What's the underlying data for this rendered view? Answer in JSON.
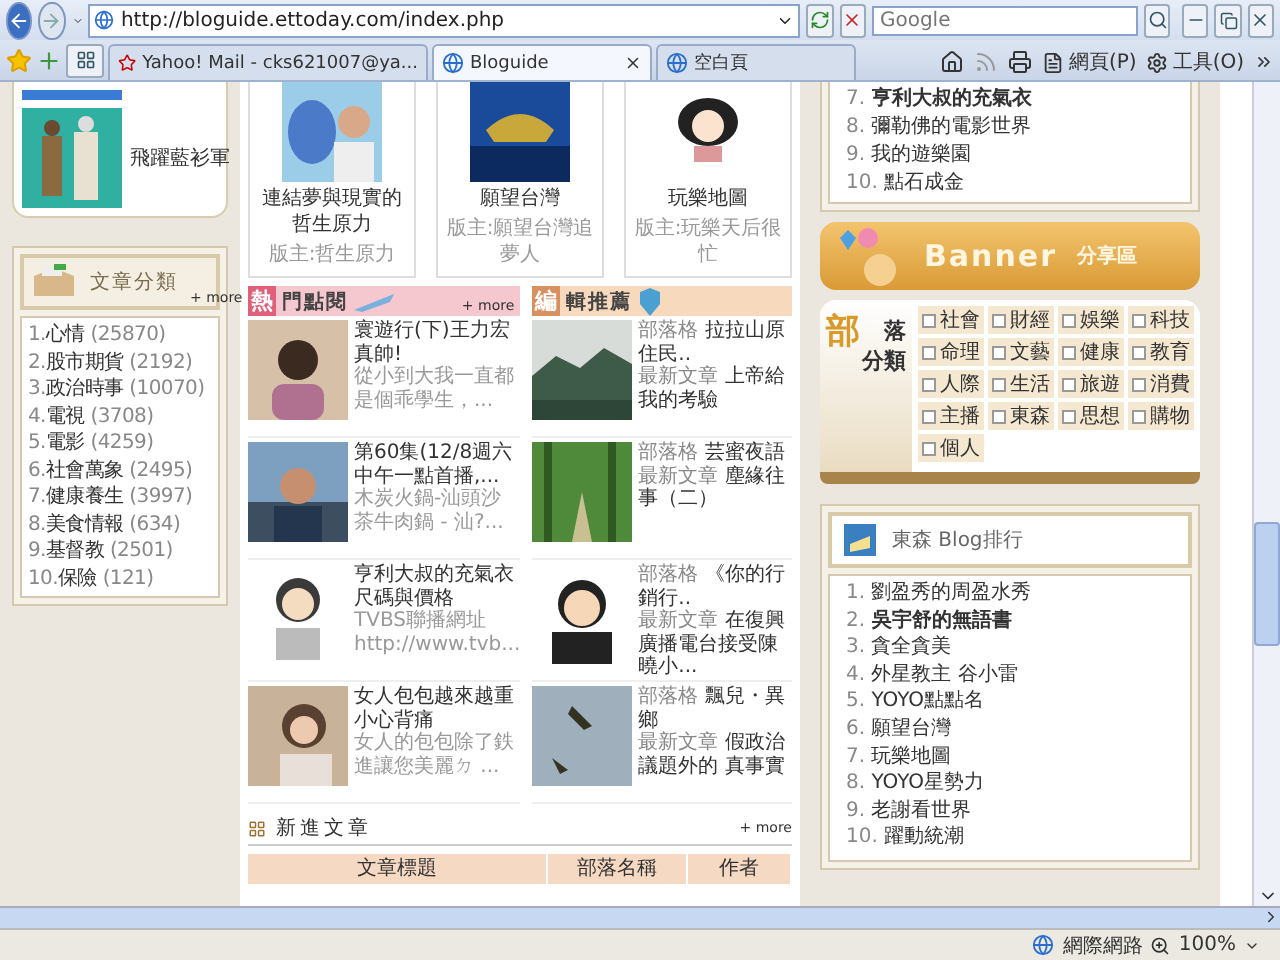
{
  "browser": {
    "url": "http://bloguide.ettoday.com/index.php",
    "search_placeholder": "Google",
    "tabs": [
      {
        "label": "Yahoo! Mail - cks621007@ya...",
        "kind": "yahoo",
        "selected": false
      },
      {
        "label": "Bloguide",
        "kind": "ie",
        "selected": true
      },
      {
        "label": "空白頁",
        "kind": "ie",
        "selected": false
      }
    ],
    "menus": [
      "網頁(P)",
      "工具(O)"
    ]
  },
  "left": {
    "featured": {
      "name": "飛躍藍衫軍"
    },
    "categories": {
      "title": "文章分類",
      "more": "+ more",
      "items": [
        {
          "rank": "1.",
          "name": "心情",
          "count": "(25870)"
        },
        {
          "rank": "2.",
          "name": "股市期貨",
          "count": "(2192)"
        },
        {
          "rank": "3.",
          "name": "政治時事",
          "count": "(10070)"
        },
        {
          "rank": "4.",
          "name": "電視",
          "count": "(3708)"
        },
        {
          "rank": "5.",
          "name": "電影",
          "count": "(4259)"
        },
        {
          "rank": "6.",
          "name": "社會萬象",
          "count": "(2495)"
        },
        {
          "rank": "7.",
          "name": "健康養生",
          "count": "(3997)"
        },
        {
          "rank": "8.",
          "name": "美食情報",
          "count": "(634)"
        },
        {
          "rank": "9.",
          "name": "基督教",
          "count": "(2501)"
        },
        {
          "rank": "10.",
          "name": "保險",
          "count": "(121)"
        }
      ]
    }
  },
  "blog_cards": [
    {
      "title": "連結夢與現實的哲生原力",
      "owner": "版主:哲生原力"
    },
    {
      "title": "願望台灣",
      "owner": "版主:願望台灣追夢人"
    },
    {
      "title": "玩樂地圖",
      "owner": "版主:玩樂天后很忙"
    }
  ],
  "hot": {
    "badge": "熱",
    "title": "門點閱",
    "more": "+ more",
    "items": [
      {
        "title": "寰遊行(下)王力宏真帥!",
        "excerpt": "從小到大我一直都是個乖學生，..."
      },
      {
        "title": "第60集(12/8週六中午一點首播,...",
        "excerpt": "木炭火鍋-汕頭沙茶牛肉鍋 - 汕?..."
      },
      {
        "title": "亨利大叔的充氣衣尺碼與價格",
        "excerpt": "TVBS聯播網址 http://www.tvb..."
      },
      {
        "title": "女人包包越來越重小心背痛",
        "excerpt": "女人的包包除了鉄進讓您美麗ㄉ ..."
      }
    ]
  },
  "editor": {
    "badge": "編",
    "title": "輯推薦",
    "items": [
      {
        "blog_label": "部落格",
        "blog": "拉拉山原住民..",
        "post_label": "最新文章",
        "post": "上帝給我的考驗"
      },
      {
        "blog_label": "部落格",
        "blog": "芸蜜夜語",
        "post_label": "最新文章",
        "post": "塵緣往事（二）"
      },
      {
        "blog_label": "部落格",
        "blog": "《你的行銷行..",
        "post_label": "最新文章",
        "post": "在復興廣播電台接受陳曉小..."
      },
      {
        "blog_label": "部落格",
        "blog": "飄兒・異鄉",
        "post_label": "最新文章",
        "post": "假政治議題外的 真事實"
      }
    ]
  },
  "new_posts": {
    "title": "新進文章",
    "more": "+ more",
    "columns": [
      "文章標題",
      "部落名稱",
      "作者"
    ]
  },
  "right": {
    "top_list": [
      {
        "rank": "7.",
        "name": "亨利大叔的充氣衣",
        "bold": true
      },
      {
        "rank": "8.",
        "name": "彌勒佛的電影世界",
        "bold": false
      },
      {
        "rank": "9.",
        "name": "我的遊樂園",
        "bold": false
      },
      {
        "rank": "10.",
        "name": "點石成金",
        "bold": false
      }
    ],
    "banner": {
      "title": "Banner",
      "subtitle": "分享區"
    },
    "categories": {
      "accent": "部",
      "title_lines": [
        "落",
        "分類"
      ],
      "items": [
        "社會",
        "財經",
        "娛樂",
        "科技",
        "命理",
        "文藝",
        "健康",
        "教育",
        "人際",
        "生活",
        "旅遊",
        "消費",
        "主播",
        "東森",
        "思想",
        "購物",
        "個人"
      ]
    },
    "ranking": {
      "title": "東森 Blog排行",
      "items": [
        {
          "rank": "1.",
          "name": "劉盈秀的周盈水秀",
          "bold": false
        },
        {
          "rank": "2.",
          "name": "吳宇舒的無語書",
          "bold": true
        },
        {
          "rank": "3.",
          "name": "貪全貪美",
          "bold": false
        },
        {
          "rank": "4.",
          "name": "外星教主 谷小雷",
          "bold": false
        },
        {
          "rank": "5.",
          "name": "YOYO點點名",
          "bold": false
        },
        {
          "rank": "6.",
          "name": "願望台灣",
          "bold": false
        },
        {
          "rank": "7.",
          "name": "玩樂地圖",
          "bold": false
        },
        {
          "rank": "8.",
          "name": "YOYO星勢力",
          "bold": false
        },
        {
          "rank": "9.",
          "name": "老謝看世界",
          "bold": false
        },
        {
          "rank": "10.",
          "name": "躍動統潮",
          "bold": false
        }
      ]
    }
  },
  "status": {
    "zone": "網際網路",
    "zoom": "100%"
  }
}
